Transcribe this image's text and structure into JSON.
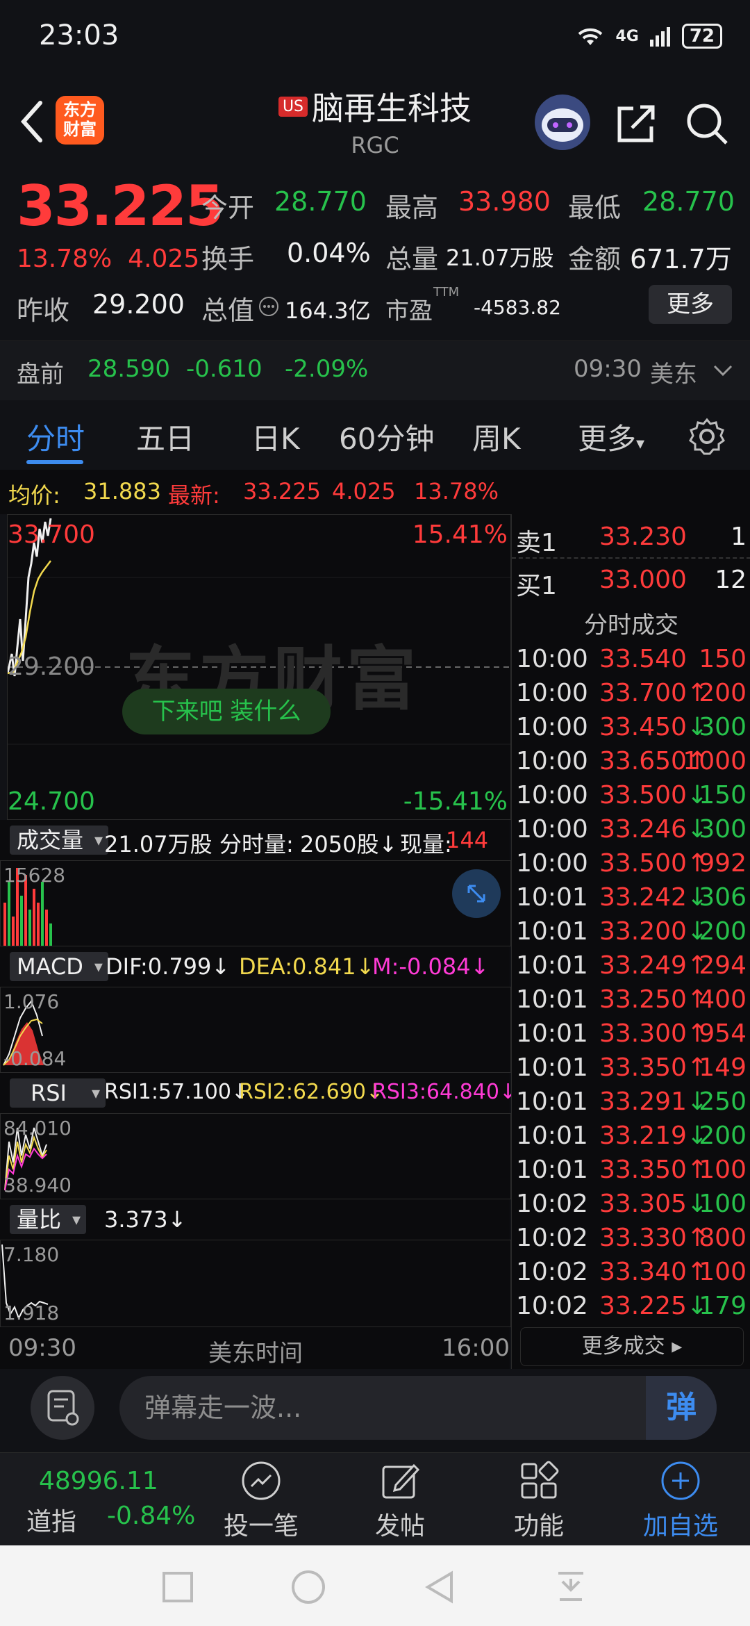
{
  "status": {
    "time": "23:03",
    "network": "4G",
    "battery": "72"
  },
  "header": {
    "logo_line1": "东方",
    "logo_line2": "财富",
    "market_badge": "US",
    "title": "脑再生科技",
    "ticker": "RGC"
  },
  "quote": {
    "price": "33.225",
    "change_pct": "13.78%",
    "change": "4.025",
    "open_label": "今开",
    "open": "28.770",
    "high_label": "最高",
    "high": "33.980",
    "low_label": "最低",
    "low": "28.770",
    "turnover_label": "换手",
    "turnover": "0.04%",
    "volume_label": "总量",
    "volume": "21.07万股",
    "amount_label": "金额",
    "amount": "671.7万",
    "prev_close_label": "昨收",
    "prev_close": "29.200",
    "market_cap_label": "总值",
    "market_cap": "164.3亿",
    "pe_label": "市盈",
    "pe_sup": "TTM",
    "pe": "-4583.82",
    "more_button": "更多"
  },
  "premarket": {
    "label": "盘前",
    "price": "28.590",
    "change": "-0.610",
    "change_pct": "-2.09%",
    "time": "09:30",
    "zone": "美东"
  },
  "tabs": [
    "分时",
    "五日",
    "日K",
    "60分钟",
    "周K",
    "更多"
  ],
  "chart": {
    "avg_label": "均价:",
    "avg": "31.883",
    "latest_label": "最新:",
    "latest": "33.225",
    "latest_change": "4.025",
    "latest_pct": "13.78%",
    "y_top": "33.700",
    "y_mid": "29.200",
    "y_bottom": "24.700",
    "pct_top": "15.41%",
    "pct_bottom": "-15.41%",
    "watermark": "东方财富",
    "danmu": "下来吧 装什么",
    "volume": {
      "selector": "成交量",
      "total": "21.07万股",
      "minute_label": "分时量:",
      "minute": "2050股↓",
      "now_label": "现量:",
      "now": "144股",
      "axis_top": "15628"
    },
    "macd": {
      "selector": "MACD",
      "dif": "DIF:0.799↓",
      "dea": "DEA:0.841↓",
      "m": "M:-0.084↓",
      "axis_top": "1.076",
      "axis_bottom": "-0.084"
    },
    "rsi": {
      "selector": "RSI",
      "rsi1": "RSI1:57.100↓",
      "rsi2": "RSI2:62.690↓",
      "rsi3": "RSI3:64.840↓",
      "axis_top": "84.010",
      "axis_bottom": "38.940"
    },
    "lb": {
      "selector": "量比",
      "value": "3.373↓",
      "axis_top": "7.180",
      "axis_bottom": "1.918"
    },
    "time_start": "09:30",
    "time_label": "美东时间",
    "time_end": "16:00"
  },
  "book": {
    "ask_label": "卖1",
    "ask_price": "33.230",
    "ask_vol": "1",
    "bid_label": "买1",
    "bid_price": "33.000",
    "bid_vol": "12",
    "trades_title": "分时成交",
    "trades": [
      {
        "t": "10:00",
        "p": "33.540",
        "v": "150",
        "d": ""
      },
      {
        "t": "10:00",
        "p": "33.700↑",
        "v": "200",
        "d": "up"
      },
      {
        "t": "10:00",
        "p": "33.450↓",
        "v": "300",
        "d": "down"
      },
      {
        "t": "10:00",
        "p": "33.650↑",
        "v": "1000",
        "d": "up"
      },
      {
        "t": "10:00",
        "p": "33.500↓",
        "v": "150",
        "d": "down"
      },
      {
        "t": "10:00",
        "p": "33.246↓",
        "v": "300",
        "d": "down"
      },
      {
        "t": "10:00",
        "p": "33.500↑",
        "v": "992",
        "d": "up"
      },
      {
        "t": "10:01",
        "p": "33.242↓",
        "v": "306",
        "d": "down"
      },
      {
        "t": "10:01",
        "p": "33.200↓",
        "v": "200",
        "d": "down"
      },
      {
        "t": "10:01",
        "p": "33.249↑",
        "v": "294",
        "d": "up"
      },
      {
        "t": "10:01",
        "p": "33.250↑",
        "v": "400",
        "d": "up"
      },
      {
        "t": "10:01",
        "p": "33.300↑",
        "v": "954",
        "d": "up"
      },
      {
        "t": "10:01",
        "p": "33.350↑",
        "v": "149",
        "d": "up"
      },
      {
        "t": "10:01",
        "p": "33.291↓",
        "v": "250",
        "d": "down"
      },
      {
        "t": "10:01",
        "p": "33.219↓",
        "v": "200",
        "d": "down"
      },
      {
        "t": "10:01",
        "p": "33.350↑",
        "v": "100",
        "d": "up"
      },
      {
        "t": "10:02",
        "p": "33.305↓",
        "v": "100",
        "d": "down"
      },
      {
        "t": "10:02",
        "p": "33.330↑",
        "v": "800",
        "d": "up"
      },
      {
        "t": "10:02",
        "p": "33.340↑",
        "v": "100",
        "d": "up"
      },
      {
        "t": "10:02",
        "p": "33.225↓",
        "v": "179",
        "d": "down"
      }
    ],
    "more_trades": "更多成交 ▸"
  },
  "comment": {
    "placeholder": "弹幕走一波...",
    "danmu_btn": "弹"
  },
  "bottom": {
    "index_value": "48996.11",
    "index_name": "道指",
    "index_change": "-0.84%",
    "items": [
      "投一笔",
      "发帖",
      "功能",
      "加自选"
    ]
  }
}
